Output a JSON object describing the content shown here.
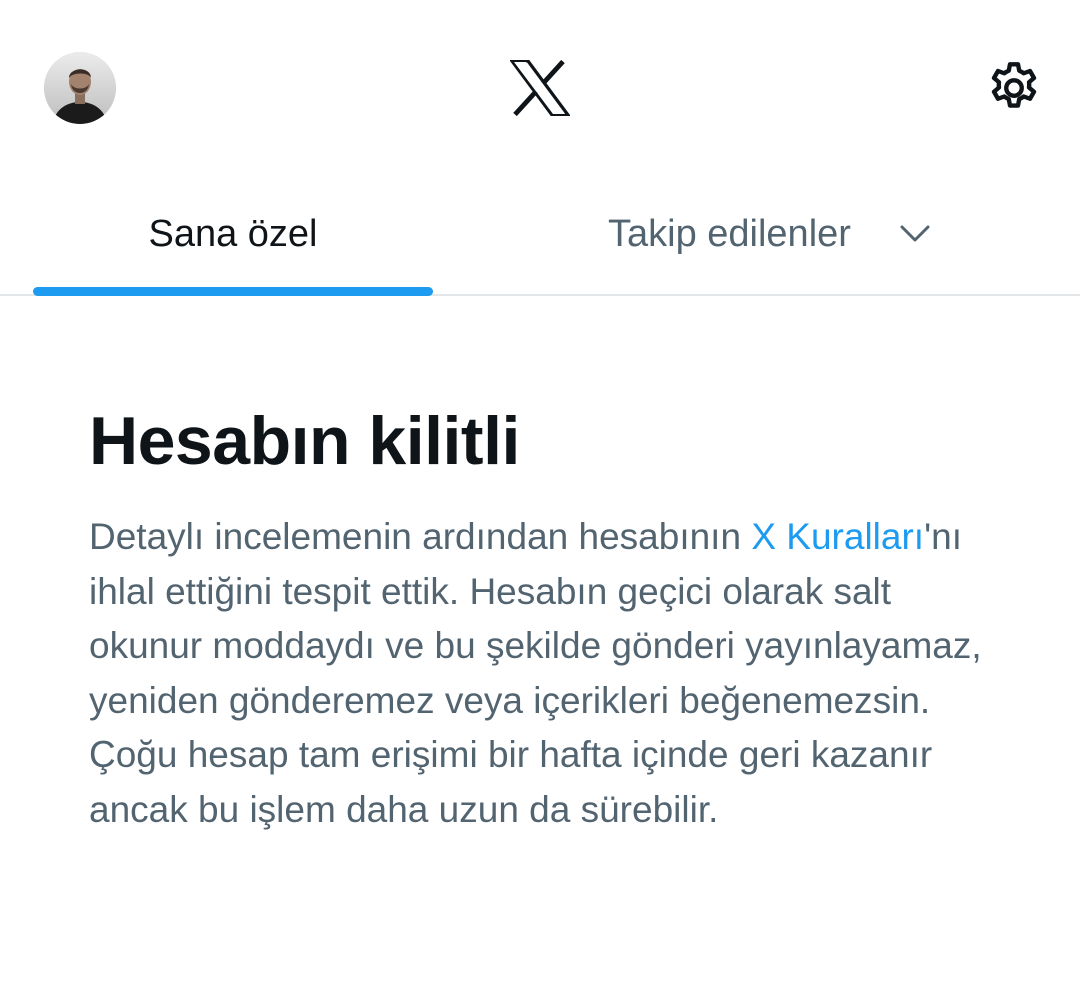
{
  "header": {
    "avatar_alt": "Profil",
    "logo_icon": "x-logo-icon",
    "settings_icon": "gear-icon"
  },
  "tabs": [
    {
      "label": "Sana özel",
      "active": true
    },
    {
      "label": "Takip edilenler",
      "active": false,
      "has_dropdown": true
    }
  ],
  "notice": {
    "title": "Hesabın kilitli",
    "body_before_link": "Detaylı incelemenin ardından hesabının ",
    "link_text": "X Kuralları",
    "body_after_link": "'nı ihlal ettiğini tespit ettik. Hesabın geçici olarak salt okunur moddaydı ve bu şekilde gönderi yayınlayamaz, yeniden gönderemez veya içerikleri beğenemezsin. Çoğu hesap tam erişimi bir hafta içinde geri kazanır ancak bu işlem daha uzun da sürebilir."
  },
  "colors": {
    "accent": "#1d9bf0",
    "text_primary": "#0f1419",
    "text_secondary": "#536471",
    "divider": "#e3e7ea"
  }
}
